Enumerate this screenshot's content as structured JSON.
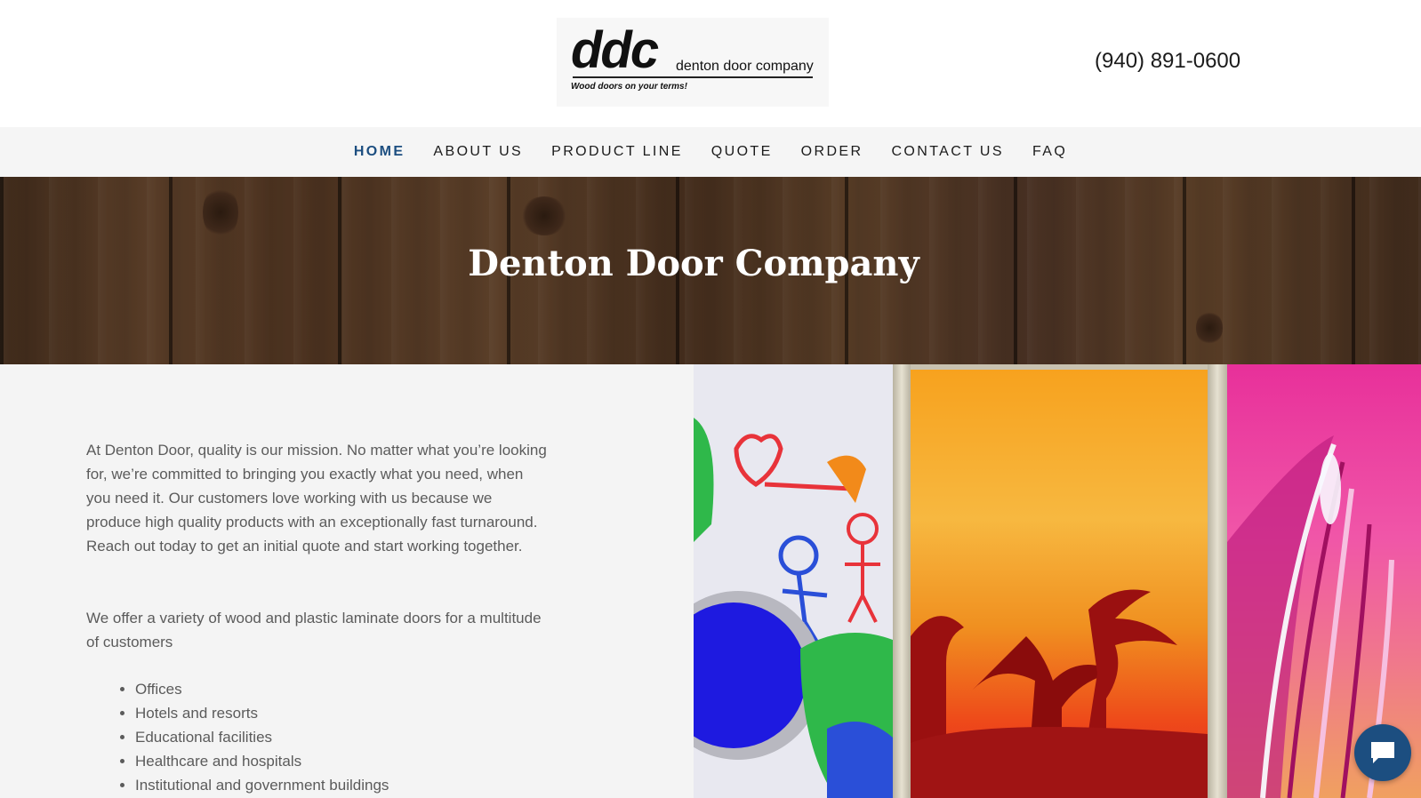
{
  "header": {
    "logo": {
      "mark": "ddc",
      "name": "denton door company",
      "tagline": "Wood doors on your terms!"
    },
    "phone": "(940) 891-0600"
  },
  "nav": {
    "items": [
      {
        "label": "HOME",
        "active": true
      },
      {
        "label": "ABOUT US",
        "active": false
      },
      {
        "label": "PRODUCT LINE",
        "active": false
      },
      {
        "label": "QUOTE",
        "active": false
      },
      {
        "label": "ORDER",
        "active": false
      },
      {
        "label": "CONTACT US",
        "active": false
      },
      {
        "label": "FAQ",
        "active": false
      }
    ],
    "active_color": "#1c4e80"
  },
  "hero": {
    "title": "Denton Door Company"
  },
  "content": {
    "paragraph_1": "At Denton Door, quality is our mission. No matter what you’re looking for, we’re committed to bringing you exactly what you need, when you need it. Our customers love working with us because we produce high quality products with an exceptionally fast turnaround. Reach out today to get an initial quote and start working together.",
    "paragraph_2": "We offer a variety of wood and plastic laminate doors for a multitude of customers",
    "customers": [
      "Offices",
      "Hotels and resorts",
      "Educational facilities",
      "Healthcare and hospitals",
      "Institutional and government buildings"
    ]
  },
  "chat": {
    "icon": "chat-bubble-icon",
    "color": "#1c4e80"
  }
}
